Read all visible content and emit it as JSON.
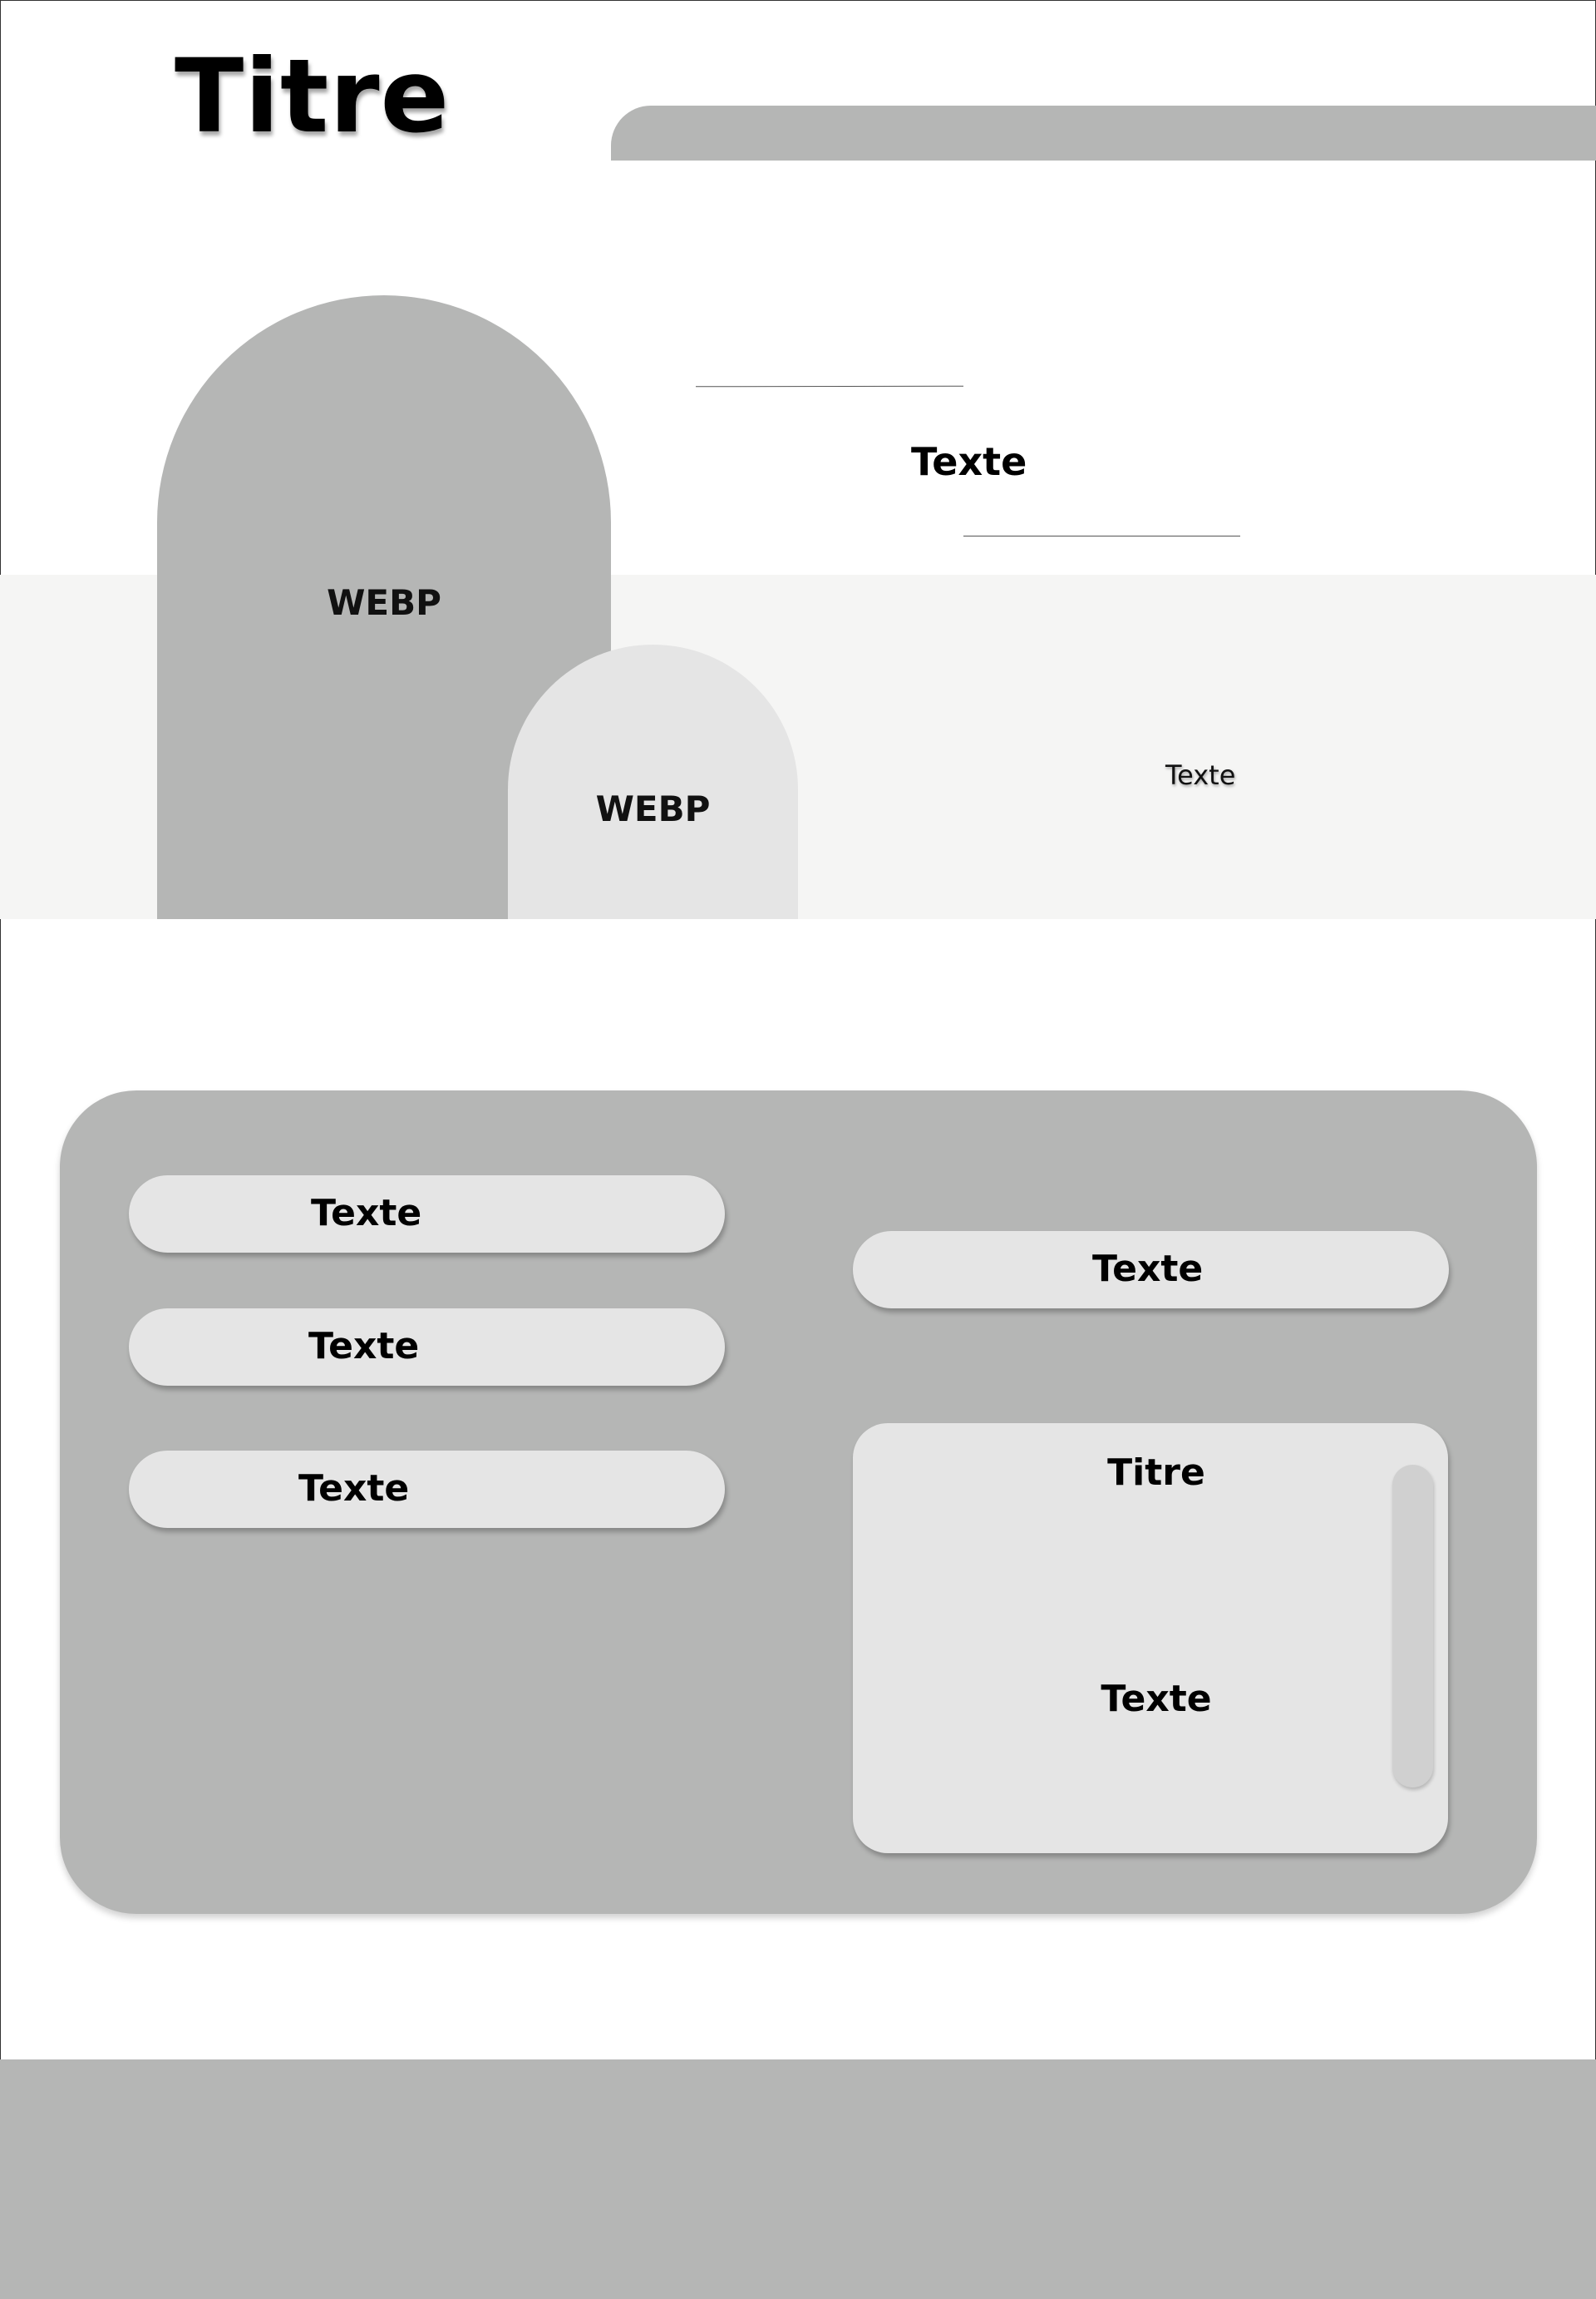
{
  "header": {
    "title": "Titre"
  },
  "hero": {
    "image_large_label": "WEBP",
    "image_small_label": "WEBP",
    "text_main": "Texte",
    "band_text": "Texte"
  },
  "panel": {
    "left_buttons": [
      {
        "label": "Texte"
      },
      {
        "label": "Texte"
      },
      {
        "label": "Texte"
      }
    ],
    "right_button": {
      "label": "Texte"
    },
    "card": {
      "title": "Titre",
      "text": "Texte"
    }
  },
  "colors": {
    "gray_dark": "#b5b6b5",
    "gray_light": "#e5e5e5",
    "band": "#f5f5f4",
    "scrollbar": "#d0d0d0"
  }
}
